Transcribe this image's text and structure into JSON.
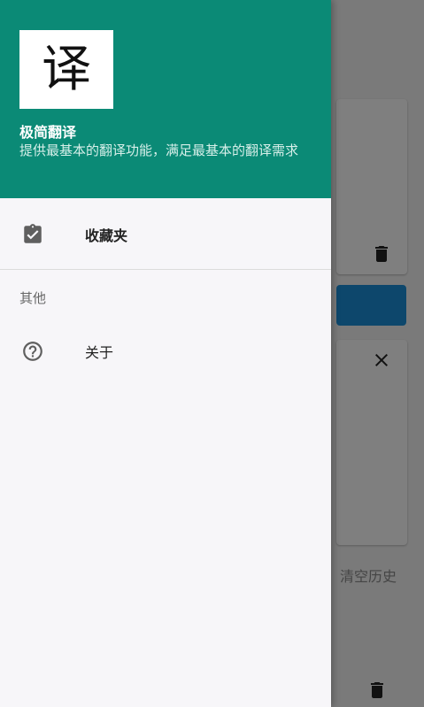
{
  "drawer": {
    "header": {
      "logo_char": "译",
      "app_title": "极简翻译",
      "app_description": "提供最基本的翻译功能，满足最基本的翻译需求",
      "background_color": "#0b8a76"
    },
    "items": [
      {
        "label": "收藏夹",
        "icon": "clipboard-check-icon"
      }
    ],
    "sections": [
      {
        "title": "其他",
        "items": [
          {
            "label": "关于",
            "icon": "help-circle-icon"
          }
        ]
      }
    ]
  },
  "background": {
    "clear_history_label": "清空历史",
    "accent_color": "#1a8ed8"
  }
}
